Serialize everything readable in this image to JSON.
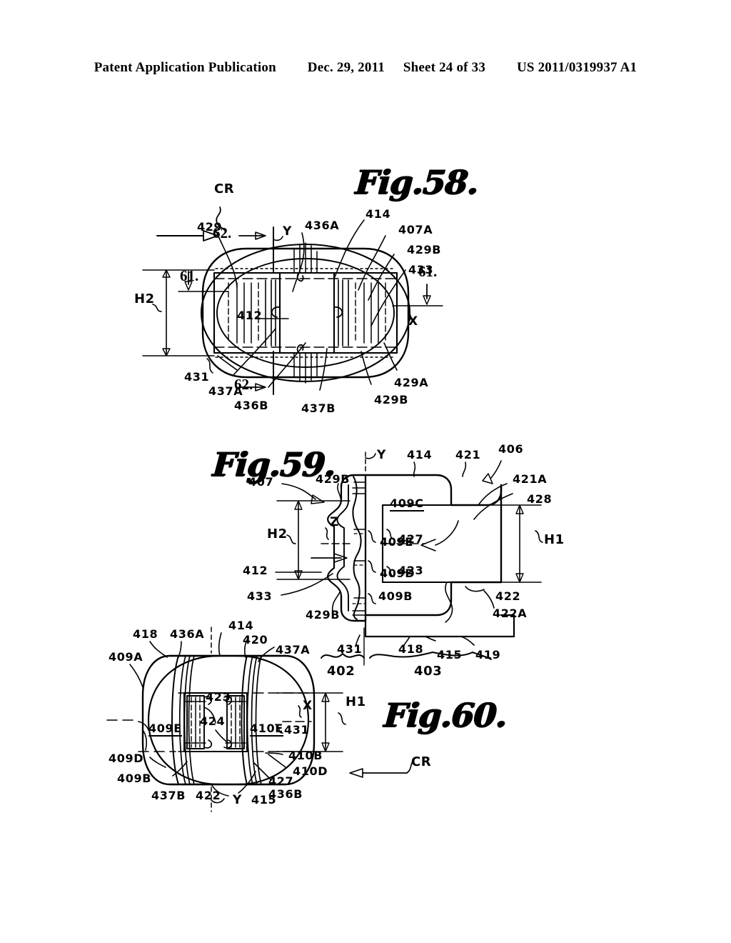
{
  "header": {
    "publication": "Patent Application Publication",
    "date": "Dec. 29, 2011",
    "sheet": "Sheet 24 of 33",
    "pub_number": "US 2011/0319937 A1"
  },
  "figures": [
    {
      "id": "fig58",
      "title": "Fig.58.",
      "labels": [
        {
          "name": "cr-arrow-label",
          "text": "CR"
        },
        {
          "name": "section-62-top",
          "text": "62."
        },
        {
          "name": "axis-y-top",
          "text": "Y"
        },
        {
          "name": "ref-429",
          "text": "429"
        },
        {
          "name": "ref-436A",
          "text": "436A"
        },
        {
          "name": "ref-414",
          "text": "414"
        },
        {
          "name": "ref-407A",
          "text": "407A"
        },
        {
          "name": "ref-429B-top",
          "text": "429B"
        },
        {
          "name": "ref-433",
          "text": "433"
        },
        {
          "name": "section-61-right",
          "text": "61."
        },
        {
          "name": "section-61-left",
          "text": "61."
        },
        {
          "name": "dim-H2",
          "text": "H2"
        },
        {
          "name": "ref-412",
          "text": "412"
        },
        {
          "name": "axis-x-right",
          "text": "X"
        },
        {
          "name": "ref-431",
          "text": "431"
        },
        {
          "name": "ref-437A",
          "text": "437A"
        },
        {
          "name": "ref-436B",
          "text": "436B"
        },
        {
          "name": "section-62-bottom",
          "text": "62."
        },
        {
          "name": "ref-437B",
          "text": "437B"
        },
        {
          "name": "ref-429B-bottom",
          "text": "429B"
        },
        {
          "name": "ref-429A",
          "text": "429A"
        }
      ]
    },
    {
      "id": "fig59",
      "title": "Fig.59.",
      "labels": [
        {
          "name": "ref-407",
          "text": "407"
        },
        {
          "name": "ref-429B-upper",
          "text": "429B"
        },
        {
          "name": "axis-y",
          "text": "Y"
        },
        {
          "name": "ref-414",
          "text": "414"
        },
        {
          "name": "ref-421",
          "text": "421"
        },
        {
          "name": "ref-406",
          "text": "406"
        },
        {
          "name": "ref-421A",
          "text": "421A"
        },
        {
          "name": "ref-428",
          "text": "428"
        },
        {
          "name": "ref-409C",
          "text": "409C"
        },
        {
          "name": "ref-409E",
          "text": "409E"
        },
        {
          "name": "ref-427",
          "text": "427"
        },
        {
          "name": "dim-H1",
          "text": "H1"
        },
        {
          "name": "dim-H2",
          "text": "H2"
        },
        {
          "name": "axis-z",
          "text": "Z"
        },
        {
          "name": "ref-423",
          "text": "423"
        },
        {
          "name": "ref-412",
          "text": "412"
        },
        {
          "name": "ref-409D",
          "text": "409D"
        },
        {
          "name": "ref-433",
          "text": "433"
        },
        {
          "name": "ref-409B",
          "text": "409B"
        },
        {
          "name": "ref-422",
          "text": "422"
        },
        {
          "name": "ref-422A",
          "text": "422A"
        },
        {
          "name": "ref-429B-lower",
          "text": "429B"
        },
        {
          "name": "ref-431",
          "text": "431"
        },
        {
          "name": "ref-418",
          "text": "418"
        },
        {
          "name": "ref-415",
          "text": "415"
        },
        {
          "name": "ref-419",
          "text": "419"
        },
        {
          "name": "brace-402",
          "text": "402"
        },
        {
          "name": "brace-403",
          "text": "403"
        }
      ]
    },
    {
      "id": "fig60",
      "title": "Fig.60.",
      "labels": [
        {
          "name": "ref-418",
          "text": "418"
        },
        {
          "name": "ref-436A",
          "text": "436A"
        },
        {
          "name": "ref-414",
          "text": "414"
        },
        {
          "name": "ref-420",
          "text": "420"
        },
        {
          "name": "ref-437A",
          "text": "437A"
        },
        {
          "name": "ref-409A",
          "text": "409A"
        },
        {
          "name": "ref-423",
          "text": "423"
        },
        {
          "name": "ref-424",
          "text": "424"
        },
        {
          "name": "ref-409E",
          "text": "409E"
        },
        {
          "name": "ref-410E",
          "text": "410E"
        },
        {
          "name": "axis-x",
          "text": "X"
        },
        {
          "name": "dim-H1",
          "text": "H1"
        },
        {
          "name": "ref-431",
          "text": "431"
        },
        {
          "name": "ref-410B",
          "text": "410B"
        },
        {
          "name": "ref-410D",
          "text": "410D"
        },
        {
          "name": "ref-409D",
          "text": "409D"
        },
        {
          "name": "ref-409B",
          "text": "409B"
        },
        {
          "name": "ref-437B",
          "text": "437B"
        },
        {
          "name": "ref-422",
          "text": "422"
        },
        {
          "name": "axis-y",
          "text": "Y"
        },
        {
          "name": "ref-415",
          "text": "415"
        },
        {
          "name": "ref-427",
          "text": "427"
        },
        {
          "name": "ref-436B",
          "text": "436B"
        },
        {
          "name": "cr-arrow-label",
          "text": "CR"
        }
      ]
    }
  ]
}
